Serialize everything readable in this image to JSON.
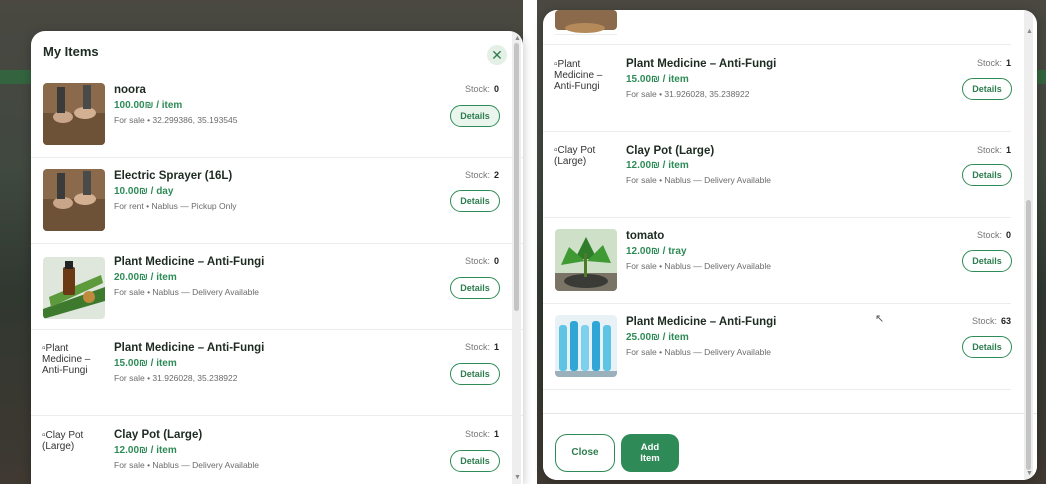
{
  "left_panel": {
    "title": "My Items",
    "close_icon": "close-icon",
    "items": [
      {
        "name": "noora",
        "price": "100.00₪ / item",
        "meta": "For sale • 32.299386, 35.193545",
        "stock_label": "Stock:",
        "stock": "0",
        "details": "Details",
        "image": "photo",
        "image_alt": ""
      },
      {
        "name": "Electric Sprayer (16L)",
        "price": "10.00₪ / day",
        "meta": "For rent • Nablus — Pickup Only",
        "stock_label": "Stock:",
        "stock": "2",
        "details": "Details",
        "image": "photo",
        "image_alt": ""
      },
      {
        "name": "Plant Medicine – Anti-Fungi",
        "price": "20.00₪ / item",
        "meta": "For sale • Nablus — Delivery Available",
        "stock_label": "Stock:",
        "stock": "0",
        "details": "Details",
        "image": "photo",
        "image_alt": ""
      },
      {
        "name": "Plant Medicine – Anti-Fungi",
        "price": "15.00₪ / item",
        "meta": "For sale • 31.926028, 35.238922",
        "stock_label": "Stock:",
        "stock": "1",
        "details": "Details",
        "image": "broken",
        "image_alt": "Plant Medicine – Anti-Fungi"
      },
      {
        "name": "Clay Pot (Large)",
        "price": "12.00₪ / item",
        "meta": "For sale • Nablus — Delivery Available",
        "stock_label": "Stock:",
        "stock": "1",
        "details": "Details",
        "image": "broken",
        "image_alt": "Clay Pot (Large)"
      }
    ]
  },
  "right_panel": {
    "items": [
      {
        "name": "Plant Medicine – Anti-Fungi",
        "price": "15.00₪ / item",
        "meta": "For sale • 31.926028, 35.238922",
        "stock_label": "Stock:",
        "stock": "1",
        "details": "Details",
        "image": "broken",
        "image_alt": "Plant Medicine – Anti-Fungi"
      },
      {
        "name": "Clay Pot (Large)",
        "price": "12.00₪ / item",
        "meta": "For sale • Nablus — Delivery Available",
        "stock_label": "Stock:",
        "stock": "1",
        "details": "Details",
        "image": "broken",
        "image_alt": "Clay Pot (Large)"
      },
      {
        "name": "tomato",
        "price": "12.00₪ / tray",
        "meta": "For sale • Nablus — Delivery Available",
        "stock_label": "Stock:",
        "stock": "0",
        "details": "Details",
        "image": "photo",
        "image_alt": ""
      },
      {
        "name": "Plant Medicine – Anti-Fungi",
        "price": "25.00₪ / item",
        "meta": "For sale • Nablus — Delivery Available",
        "stock_label": "Stock:",
        "stock": "63",
        "details": "Details",
        "image": "photo",
        "image_alt": ""
      }
    ],
    "footer": {
      "close_label": "Close",
      "add_label": "Add Item"
    }
  },
  "colors": {
    "accent": "#2e8b57",
    "title": "#1d2b22",
    "muted": "#6b6b6b"
  }
}
